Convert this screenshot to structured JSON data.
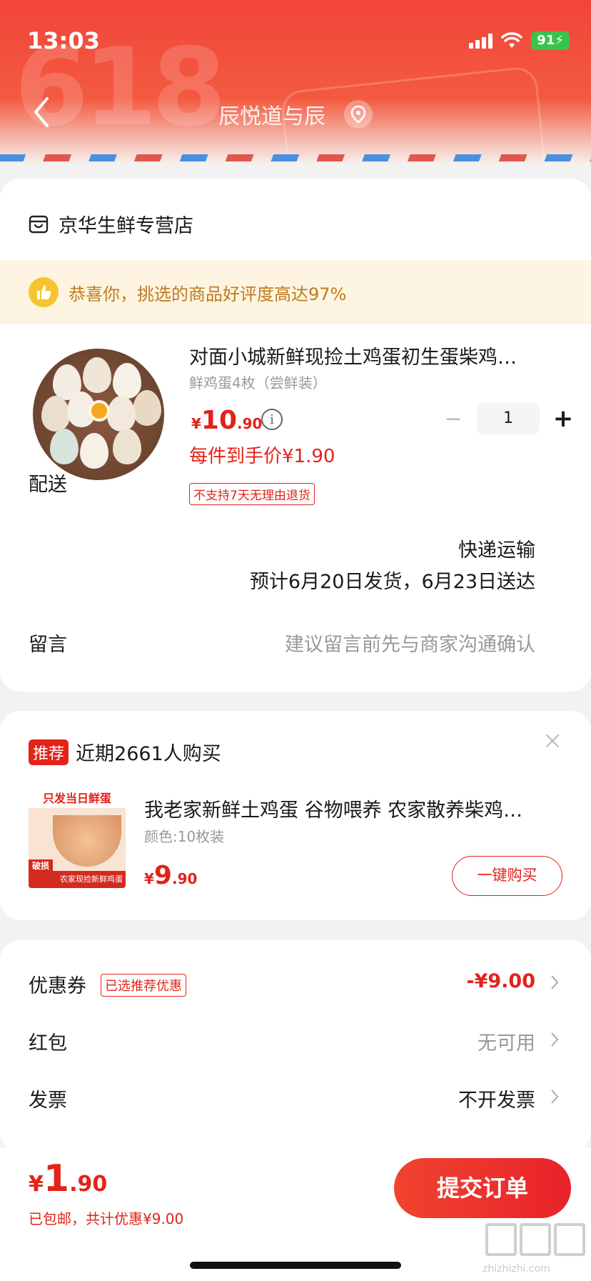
{
  "status_bar": {
    "time": "13:03",
    "battery": "91"
  },
  "header": {
    "title": "辰悦道与辰",
    "decoration_text": "618"
  },
  "shop": {
    "name": "京华生鲜专营店"
  },
  "praise_banner": {
    "text": "恭喜你，挑选的商品好评度高达97%"
  },
  "product": {
    "title": "对面小城新鲜现捡土鸡蛋初生蛋柴鸡…",
    "spec": "鲜鸡蛋4枚（尝鲜装）",
    "price_symbol": "¥",
    "price_int": "10",
    "price_dec": ".90",
    "info_icon": "i",
    "quantity": "1",
    "qty_minus": "−",
    "qty_plus": "+",
    "unit_price": "每件到手价¥1.90",
    "return_policy": "不支持7天无理由退货"
  },
  "delivery": {
    "label": "配送",
    "method": "快递运输",
    "estimate": "预计6月20日发货，6月23日送达"
  },
  "remark": {
    "label": "留言",
    "placeholder": "建议留言前先与商家沟通确认"
  },
  "recommend": {
    "tag": "推荐",
    "text": "近期2661人购买",
    "image_top_text": "只发当日鲜蛋",
    "image_bottom_text": "农家现捡新鲜鸡蛋",
    "image_badge": "破损包赔",
    "title": "我老家新鲜土鸡蛋 谷物喂养 农家散养柴鸡…",
    "spec": "颜色:10枚装",
    "price_symbol": "¥",
    "price_int": "9",
    "price_dec": ".90",
    "buy_button": "一键购买"
  },
  "options": {
    "coupon": {
      "label": "优惠券",
      "tag": "已选推荐优惠",
      "value": "-¥9.00"
    },
    "red_packet": {
      "label": "红包",
      "value": "无可用"
    },
    "invoice": {
      "label": "发票",
      "value": "不开发票"
    }
  },
  "footer": {
    "total_symbol": "¥",
    "total_int": "1",
    "total_dec": ".90",
    "sub": "已包邮，共计优惠¥9.00",
    "submit": "提交订单"
  },
  "watermark": {
    "url": "zhizhizhi.com"
  },
  "colors": {
    "brand_red": "#e2231a",
    "header_red": "#f2453a",
    "praise_text": "#c07a1f",
    "praise_bg": "#fdf5e1"
  }
}
